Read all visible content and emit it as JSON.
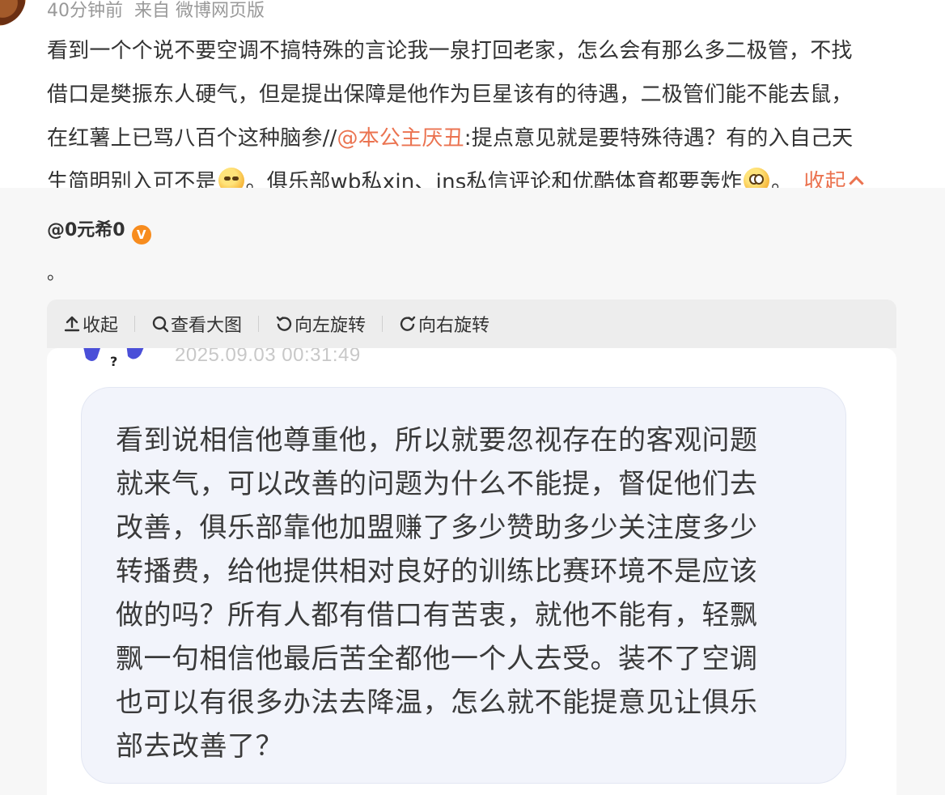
{
  "post": {
    "meta_time": "40分钟前",
    "meta_source": "来自 微博网页版",
    "text_lines": [
      "看到一个个说不要空调不搞特殊的言论我一泉打回老家，怎么会有那么多二极管，不找",
      "借口是樊振东人硬气，但是提出保障是他作为巨星该有的待遇，二极管们能不能去鼠，"
    ],
    "line3_before": "在红薯上已骂八百个这种脑参//",
    "line3_mention": "@本公主厌丑",
    "line3_after": ":提点意见就是要特殊待遇？有的入自己天",
    "line4_before": "生简明别入可不是",
    "line4_middle": "。俱乐部wb私xin、ins私信评论和优酷体育都要轰炸",
    "line4_after": "。",
    "collapse_label": "收起",
    "emoji1": "thinking-face-emoji",
    "emoji2": "cute-face-emoji"
  },
  "repost": {
    "author": "@0元希0",
    "verified_badge": "V",
    "text": "。"
  },
  "image_toolbar": {
    "collapse": "收起",
    "view_large": "查看大图",
    "rotate_left": "向左旋转",
    "rotate_right": "向右旋转"
  },
  "image": {
    "timestamp": "2025.09.03 00:31:49",
    "bubble_lines": [
      "看到说相信他尊重他，所以就要忽视存在的客观问题",
      "就来气，可以改善的问题为什么不能提，督促他们去",
      "改善，俱乐部靠他加盟赚了多少赞助多少关注度多少",
      "转播费，给他提供相对良好的训练比赛环境不是应该",
      "做的吗？所有人都有借口有苦衷，就他不能有，轻飘",
      "飘一句相信他最后苦全都他一个人去受。装不了空调",
      "也可以有很多办法去降温，怎么就不能提意见让俱乐",
      "部去改善了？"
    ]
  },
  "colors": {
    "accent": "#eb7350",
    "meta_gray": "#999999",
    "repost_bg": "#f7f7f7",
    "badge": "#f78c1e",
    "bubble_bg": "#f2f4fb"
  }
}
